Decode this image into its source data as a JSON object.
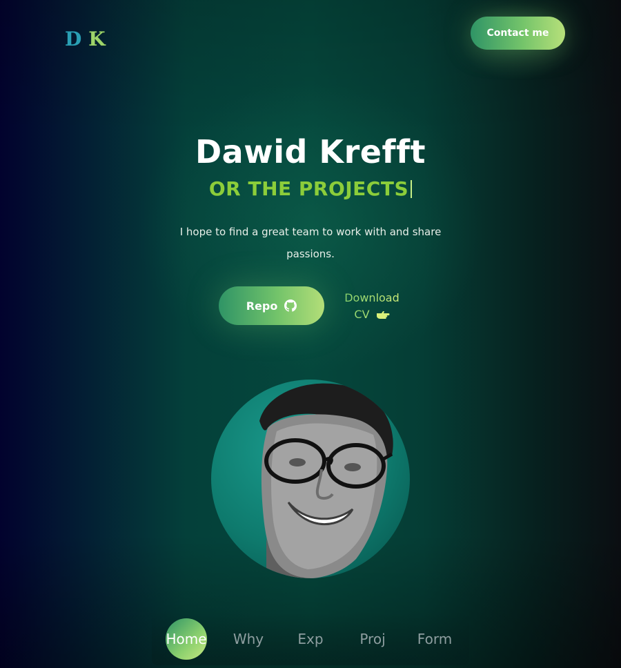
{
  "logo": {
    "letter1": "D",
    "letter2": "K"
  },
  "header": {
    "contact_label": "Contact me"
  },
  "hero": {
    "name": "Dawid Krefft",
    "typed_text": "OR THE PROJECTS",
    "description": "I hope to find a great team to work with and share passions."
  },
  "cta": {
    "repo_label": "Repo",
    "repo_icon": "github-icon",
    "download_label": "Download CV",
    "download_icon": "pointing-hand-icon"
  },
  "nav": {
    "items": [
      {
        "label": "Home",
        "active": true
      },
      {
        "label": "Why",
        "active": false
      },
      {
        "label": "Exp",
        "active": false
      },
      {
        "label": "Proj",
        "active": false
      },
      {
        "label": "Form",
        "active": false
      }
    ]
  },
  "colors": {
    "accent_green": "#8ccd3a",
    "button_gradient_start": "#2f9466",
    "button_gradient_end": "#b7e07a",
    "logo_d": "#2a9fb4",
    "logo_k": "#9ed46a"
  }
}
